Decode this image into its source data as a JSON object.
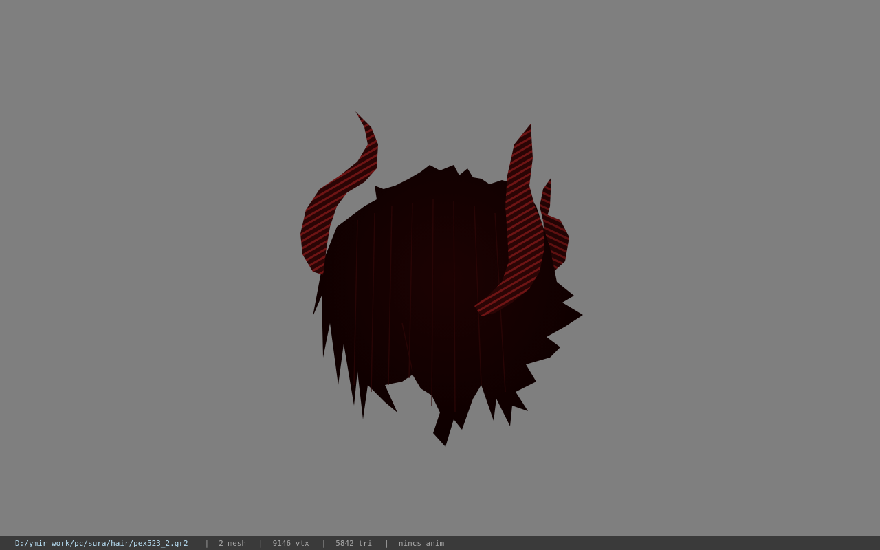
{
  "viewport": {
    "background": "#7f7f7f",
    "model_name": "pex523_2"
  },
  "statusbar": {
    "file_path": "D:/ymir work/pc/sura/hair/pex523_2.gr2",
    "mesh_count": "2 mesh",
    "vertex_count": "9146 vtx",
    "triangle_count": "5842 tri",
    "anim_status": "nincs anim",
    "separator": "|",
    "path_color": "#b8dff5"
  }
}
